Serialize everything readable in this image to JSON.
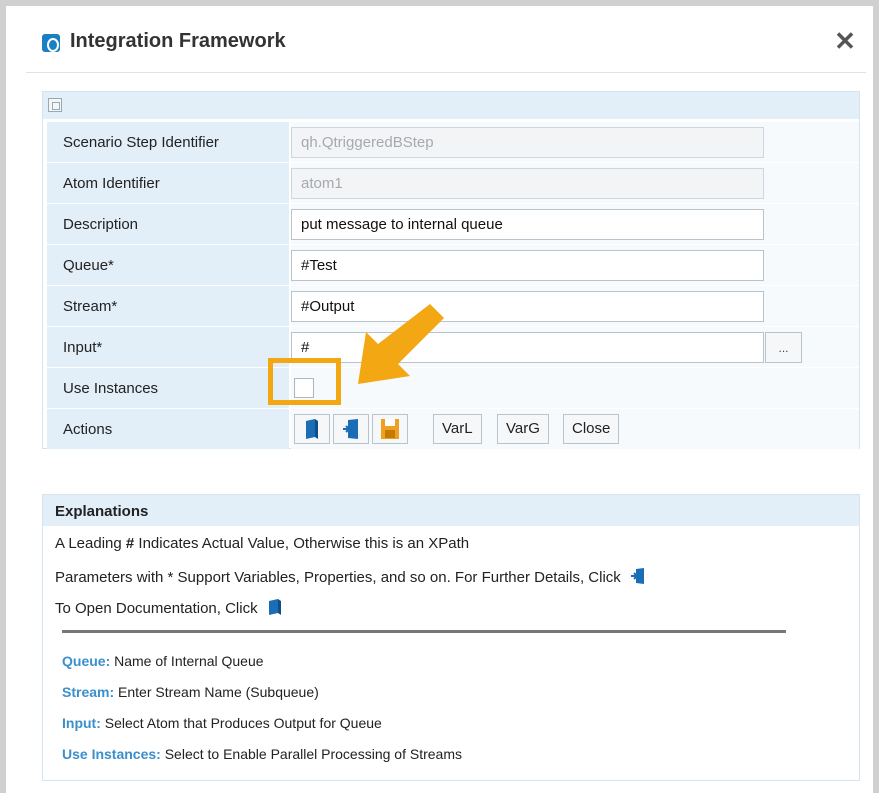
{
  "dialog": {
    "title": "Integration Framework",
    "close_symbol": "✕"
  },
  "form": {
    "rows": [
      {
        "label": "Scenario Step Identifier",
        "value": "qh.QtriggeredBStep",
        "disabled": true
      },
      {
        "label": "Atom Identifier",
        "value": "atom1",
        "disabled": true
      },
      {
        "label": "Description",
        "value": "put message to internal queue",
        "disabled": false
      },
      {
        "label": "Queue*",
        "value": "#Test",
        "disabled": false
      },
      {
        "label": "Stream*",
        "value": "#Output",
        "disabled": false
      },
      {
        "label": "Input*",
        "value": "#",
        "disabled": false
      }
    ],
    "input_browse_label": "...",
    "use_instances_label": "Use Instances",
    "use_instances_checked": false,
    "actions_label": "Actions",
    "action_buttons": {
      "varl": "VarL",
      "varg": "VarG",
      "close": "Close"
    }
  },
  "explanations": {
    "title": "Explanations",
    "line1_pre": "A Leading ",
    "line1_bold": "#",
    "line1_post": " Indicates Actual Value, Otherwise this is an XPath",
    "line2": "Parameters with * Support Variables, Properties, and so on. For Further Details, Click",
    "line3": "To Open Documentation, Click",
    "definitions": [
      {
        "term": "Queue:",
        "text": " Name of Internal Queue"
      },
      {
        "term": "Stream:",
        "text": " Enter Stream Name (Subqueue)"
      },
      {
        "term": "Input:",
        "text": " Select Atom that Produces Output for Queue"
      },
      {
        "term": "Use Instances:",
        "text": " Select to Enable Parallel Processing of Streams"
      }
    ]
  },
  "colors": {
    "accent_blue": "#1b7fc3",
    "label_bg": "#e2eef8",
    "highlight_orange": "#f3a712",
    "definition_term": "#3a8fcc",
    "save_icon_orange": "#f0a020"
  },
  "icons": {
    "app": "integration-framework-icon",
    "doc": "documentation-book-icon",
    "details": "details-door-icon",
    "save": "save-disk-icon"
  }
}
